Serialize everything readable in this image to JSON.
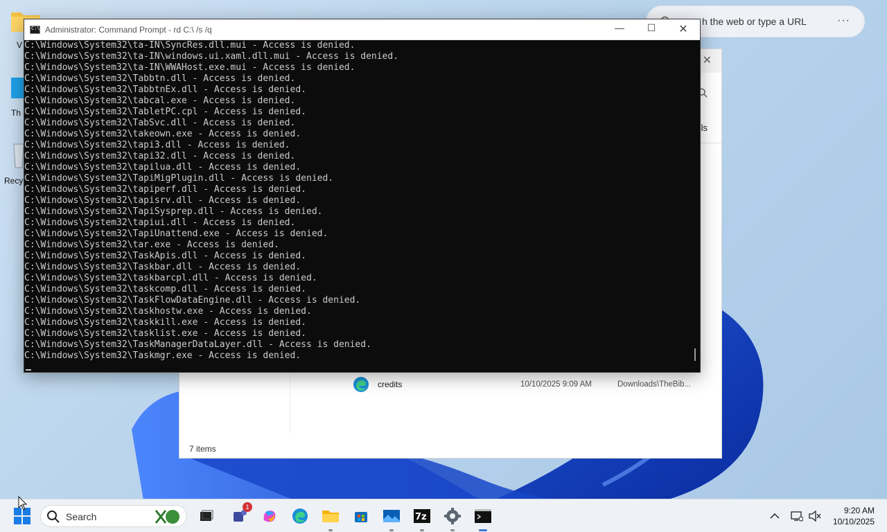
{
  "desktop": {
    "labels": [
      "V",
      "Th",
      "Recy"
    ]
  },
  "browser": {
    "search_placeholder": "Search the web or type a URL",
    "visible_placeholder": "h the web or type a URL",
    "more_label": "···"
  },
  "explorer": {
    "details_label": "ls",
    "file": {
      "name": "credits",
      "date": "10/10/2025 9:09 AM",
      "location": "Downloads\\TheBib..."
    },
    "status": "7 items",
    "close_label": "✕"
  },
  "cmd": {
    "title": "Administrator: Command Prompt - rd  C:\\ /s /q",
    "min_label": "—",
    "max_label": "☐",
    "close_label": "✕",
    "lines": [
      "C:\\Windows\\System32\\ta-IN\\SyncRes.dll.mui - Access is denied.",
      "C:\\Windows\\System32\\ta-IN\\windows.ui.xaml.dll.mui - Access is denied.",
      "C:\\Windows\\System32\\ta-IN\\WWAHost.exe.mui - Access is denied.",
      "C:\\Windows\\System32\\Tabbtn.dll - Access is denied.",
      "C:\\Windows\\System32\\TabbtnEx.dll - Access is denied.",
      "C:\\Windows\\System32\\tabcal.exe - Access is denied.",
      "C:\\Windows\\System32\\TabletPC.cpl - Access is denied.",
      "C:\\Windows\\System32\\TabSvc.dll - Access is denied.",
      "C:\\Windows\\System32\\takeown.exe - Access is denied.",
      "C:\\Windows\\System32\\tapi3.dll - Access is denied.",
      "C:\\Windows\\System32\\tapi32.dll - Access is denied.",
      "C:\\Windows\\System32\\tapilua.dll - Access is denied.",
      "C:\\Windows\\System32\\TapiMigPlugin.dll - Access is denied.",
      "C:\\Windows\\System32\\tapiperf.dll - Access is denied.",
      "C:\\Windows\\System32\\tapisrv.dll - Access is denied.",
      "C:\\Windows\\System32\\TapiSysprep.dll - Access is denied.",
      "C:\\Windows\\System32\\tapiui.dll - Access is denied.",
      "C:\\Windows\\System32\\TapiUnattend.exe - Access is denied.",
      "C:\\Windows\\System32\\tar.exe - Access is denied.",
      "C:\\Windows\\System32\\TaskApis.dll - Access is denied.",
      "C:\\Windows\\System32\\Taskbar.dll - Access is denied.",
      "C:\\Windows\\System32\\taskbarcpl.dll - Access is denied.",
      "C:\\Windows\\System32\\taskcomp.dll - Access is denied.",
      "C:\\Windows\\System32\\TaskFlowDataEngine.dll - Access is denied.",
      "C:\\Windows\\System32\\taskhostw.exe - Access is denied.",
      "C:\\Windows\\System32\\taskkill.exe - Access is denied.",
      "C:\\Windows\\System32\\tasklist.exe - Access is denied.",
      "C:\\Windows\\System32\\TaskManagerDataLayer.dll - Access is denied.",
      "C:\\Windows\\System32\\Taskmgr.exe - Access is denied."
    ]
  },
  "taskbar": {
    "search_label": "Search",
    "badge_count": "1",
    "time": "9:20 AM",
    "date": "10/10/2025",
    "items": [
      "start-icon",
      "search-input",
      "task-view-icon",
      "teams-icon",
      "copilot-icon",
      "edge-icon",
      "file-explorer-icon",
      "store-icon",
      "photos-icon",
      "7zip-icon",
      "settings-icon",
      "terminal-icon"
    ]
  },
  "colors": {
    "console_bg": "#0c0c0c",
    "console_fg": "#cccccc",
    "accent": "#3b78d8",
    "badge": "#d13438"
  }
}
